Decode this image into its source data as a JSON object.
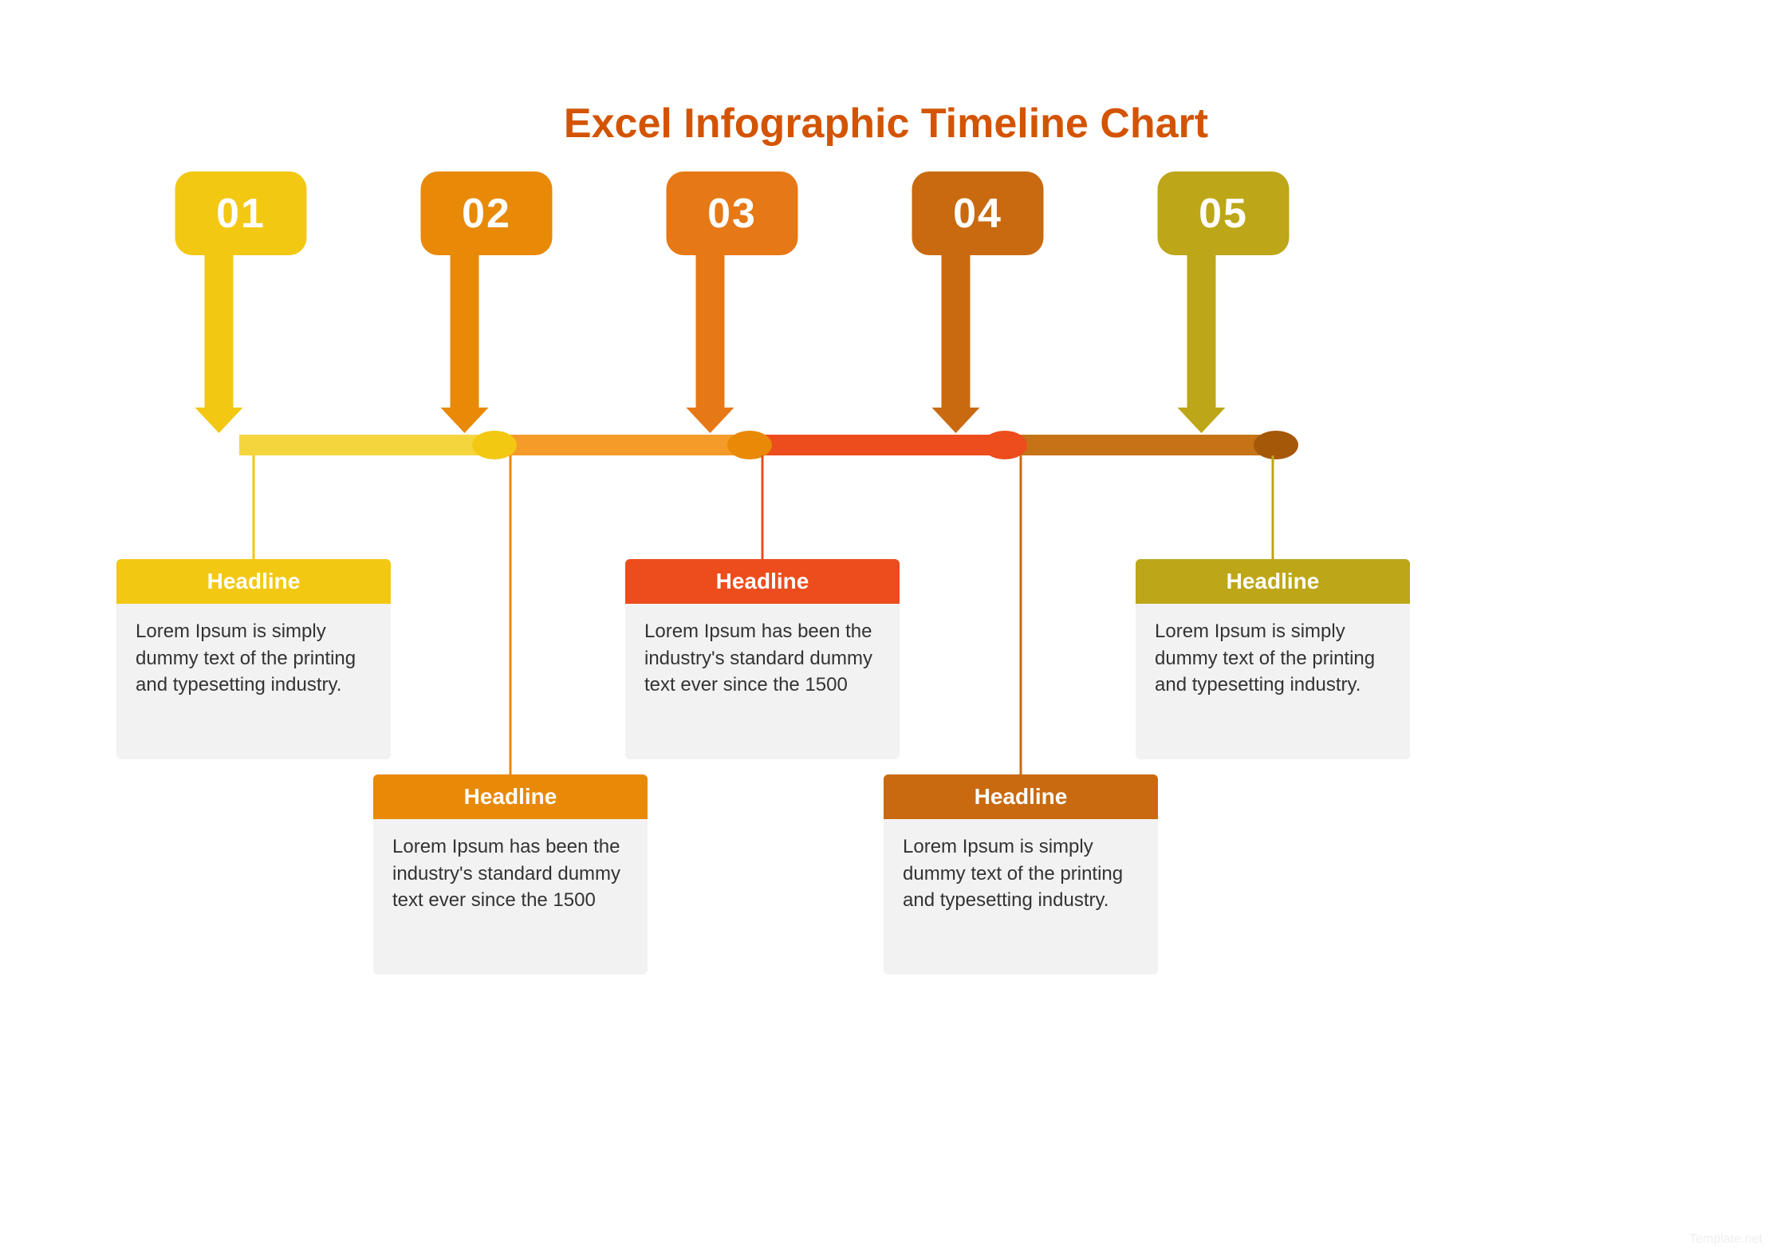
{
  "title": "Excel Infographic Timeline Chart",
  "watermark": "Template.net",
  "colors": {
    "seg1": "#f5d53d",
    "seg2": "#f49b29",
    "seg3": "#ed4c1c",
    "seg4": "#c67317",
    "node1": "#f2c813",
    "node2": "#e88908",
    "node3": "#ed4c1c",
    "node4": "#a65809",
    "badge1": "#f2c813",
    "badge2": "#e88908",
    "badge3": "#e67816",
    "badge4": "#c96a11",
    "badge5": "#bda617",
    "header1": "#f2c813",
    "header2": "#e88908",
    "header3": "#ed4c1c",
    "header4": "#c96a11",
    "header5": "#bda617"
  },
  "items": [
    {
      "num": "01",
      "headline": "Headline",
      "body": "Lorem Ipsum is simply dummy text of the printing and typesetting industry."
    },
    {
      "num": "02",
      "headline": "Headline",
      "body": "Lorem Ipsum has been the industry's standard dummy text ever since the 1500"
    },
    {
      "num": "03",
      "headline": "Headline",
      "body": "Lorem Ipsum has been the industry's standard dummy text ever since the 1500"
    },
    {
      "num": "04",
      "headline": "Headline",
      "body": "Lorem Ipsum is simply dummy text of the printing and typesetting industry."
    },
    {
      "num": "05",
      "headline": "Headline",
      "body": "Lorem Ipsum is simply dummy text of the printing and typesetting industry."
    }
  ],
  "chart_data": {
    "type": "timeline",
    "title": "Excel Infographic Timeline Chart",
    "steps": [
      {
        "order": 1,
        "label": "01",
        "headline": "Headline",
        "description": "Lorem Ipsum is simply dummy text of the printing and typesetting industry."
      },
      {
        "order": 2,
        "label": "02",
        "headline": "Headline",
        "description": "Lorem Ipsum has been the industry's standard dummy text ever since the 1500"
      },
      {
        "order": 3,
        "label": "03",
        "headline": "Headline",
        "description": "Lorem Ipsum has been the industry's standard dummy text ever since the 1500"
      },
      {
        "order": 4,
        "label": "04",
        "headline": "Headline",
        "description": "Lorem Ipsum is simply dummy text of the printing and typesetting industry."
      },
      {
        "order": 5,
        "label": "05",
        "headline": "Headline",
        "description": "Lorem Ipsum is simply dummy text of the printing and typesetting industry."
      }
    ]
  }
}
